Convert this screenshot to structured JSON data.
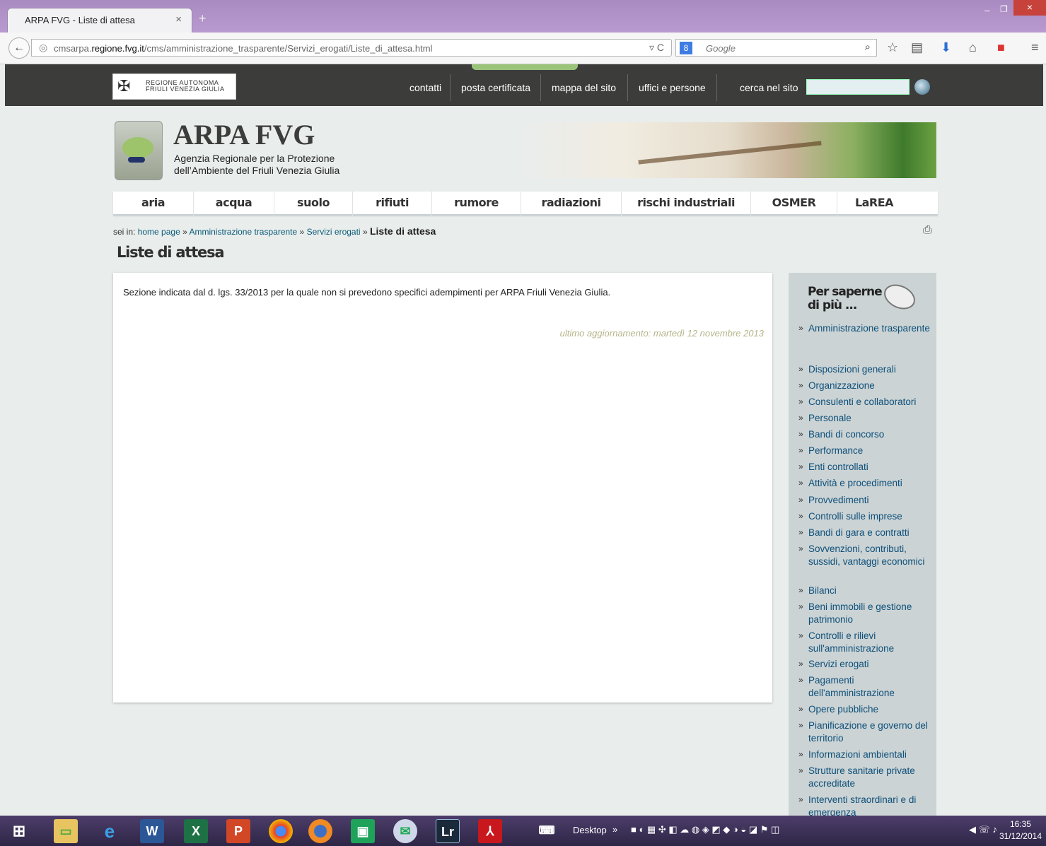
{
  "browser": {
    "tab_title": "ARPA FVG - Liste di attesa",
    "url_prefix": "cmsarpa.",
    "url_domain": "regione.fvg.it",
    "url_path": "/cms/amministrazione_trasparente/Servizi_erogati/Liste_di_attesa.html",
    "search_placeholder": "Google"
  },
  "header": {
    "region_logo_line1": "REGIONE AUTONOMA",
    "region_logo_line2": "FRIULI VENEZIA GIULIA",
    "links": [
      "contatti",
      "posta certificata",
      "mappa del sito",
      "uffici e persone"
    ],
    "search_label": "cerca nel sito"
  },
  "brand": {
    "name": "ARPA FVG",
    "subtitle_line1": "Agenzia Regionale per la Protezione",
    "subtitle_line2": "dell’Ambiente del Friuli Venezia Giulia"
  },
  "menu": [
    "aria",
    "acqua",
    "suolo",
    "rifiuti",
    "rumore",
    "radiazioni",
    "rischi industriali",
    "OSMER",
    "LaREA"
  ],
  "breadcrumb": {
    "prefix": "sei in:",
    "home": "home page",
    "level1": "Amministrazione trasparente",
    "level2": "Servizi erogati",
    "current": "Liste di attesa",
    "separator": "»"
  },
  "page": {
    "title": "Liste di attesa",
    "body": "Sezione indicata dal d. lgs. 33/2013 per la quale non si prevedono specifici adempimenti per ARPA Friuli Venezia Giulia.",
    "updated": "ultimo aggiornamento: martedì 12 novembre 2013"
  },
  "sidebar": {
    "heading_line1": "Per saperne",
    "heading_line2": "di più ...",
    "items": [
      "Amministrazione trasparente",
      "Disposizioni generali",
      "Organizzazione",
      "Consulenti e collaboratori",
      "Personale",
      "Bandi di concorso",
      "Performance",
      "Enti controllati",
      "Attività e procedimenti",
      "Provvedimenti",
      "Controlli sulle imprese",
      "Bandi di gara e contratti",
      "Sovvenzioni, contributi, sussidi, vantaggi economici",
      "Bilanci",
      "Beni immobili e gestione patrimonio",
      "Controlli e rilievi sull'amministrazione",
      "Servizi erogati",
      "Pagamenti dell'amministrazione",
      "Opere pubbliche",
      "Pianificazione e governo del territorio",
      "Informazioni ambientali",
      "Strutture sanitarie private accreditate",
      "Interventi straordinari e di emergenza"
    ]
  },
  "taskbar": {
    "desktop_label": "Desktop",
    "time": "16:35",
    "date": "31/12/2014"
  }
}
